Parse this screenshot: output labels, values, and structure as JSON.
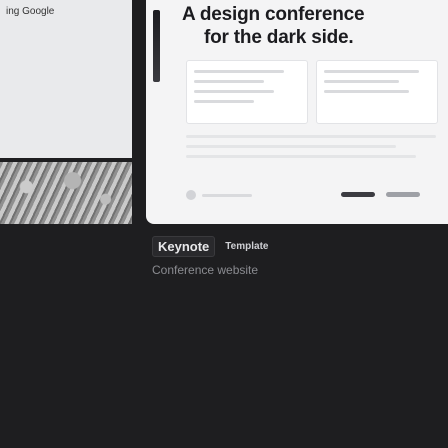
{
  "left_card": {
    "thumb_text": "ing Google"
  },
  "right_card": {
    "headline_line1": "A design conference",
    "headline_line2": "for the dark side.",
    "app_label": "Keynote",
    "badge_label": "Template",
    "subtitle": "Conference website"
  },
  "colors": {
    "background": "#1e1e20",
    "thumb_light": "#f4f4f5",
    "headline": "#1b1b1f"
  }
}
